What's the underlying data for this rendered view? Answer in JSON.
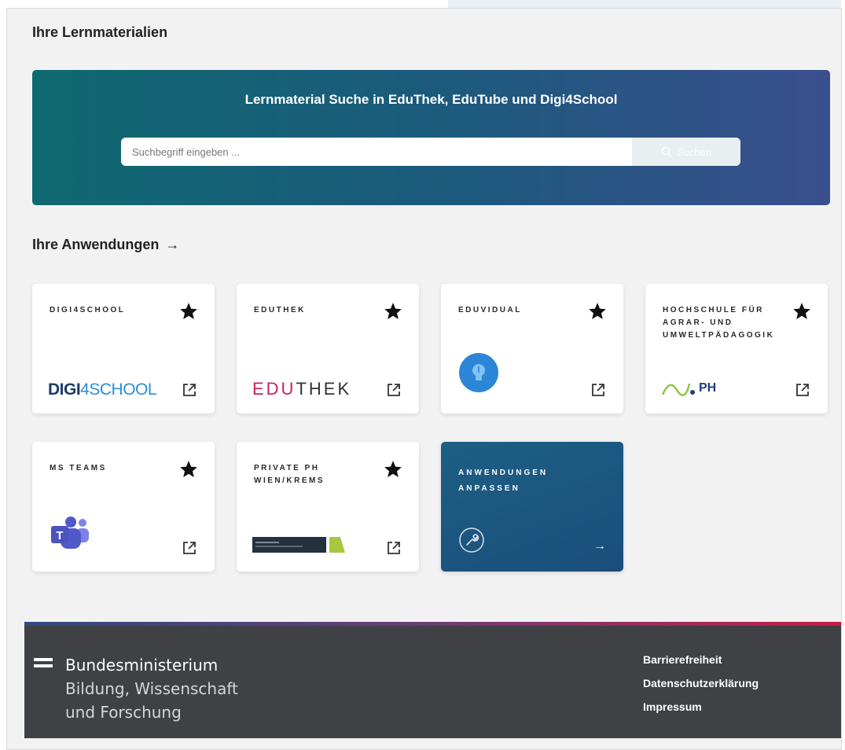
{
  "learning": {
    "section_title": "Ihre Lernmaterialien",
    "hero_title": "Lernmaterial Suche in EduThek, EduTube und Digi4School",
    "search_placeholder": "Suchbegriff eingeben ...",
    "search_button_label": "Suchen"
  },
  "apps": {
    "section_title": "Ihre Anwendungen",
    "arrow": "→",
    "tiles": [
      {
        "label": "DIGI4SCHOOL",
        "logo": "digi4school-logo",
        "favorite": true
      },
      {
        "label": "EDUTHEK",
        "logo": "eduthek-logo",
        "favorite": true
      },
      {
        "label": "EDUVIDUAL",
        "logo": "eduvidual-lightbulb-icon",
        "favorite": true
      },
      {
        "label": "HOCHSCHULE FÜR AGRAR- UND UMWELTPÄDAGOGIK",
        "logo": "ph-logo",
        "favorite": true
      },
      {
        "label": "MS TEAMS",
        "logo": "ms-teams-icon",
        "favorite": true
      },
      {
        "label": "PRIVATE PH WIEN/KREMS",
        "logo": "ph-wien-krems-logo",
        "favorite": true
      }
    ],
    "customize_label": "ANWENDUNGEN ANPASSEN",
    "customize_arrow": "→"
  },
  "logos": {
    "digi_a": "DIGI",
    "digi_b": "4SCHOOL",
    "edu_a": "EDU",
    "edu_b": "THEK",
    "ph": "PH",
    "teams": "T"
  },
  "footer": {
    "ministry_line1": "Bundesministerium",
    "ministry_line2": "Bildung, Wissenschaft",
    "ministry_line3": "und Forschung",
    "links": [
      "Barrierefreiheit",
      "Datenschutzerklärung",
      "Impressum"
    ]
  },
  "colors": {
    "hero_start": "#0f6970",
    "hero_end": "#3a4f8d",
    "footer_bg": "#3f4145",
    "accent_red": "#c51d45"
  }
}
